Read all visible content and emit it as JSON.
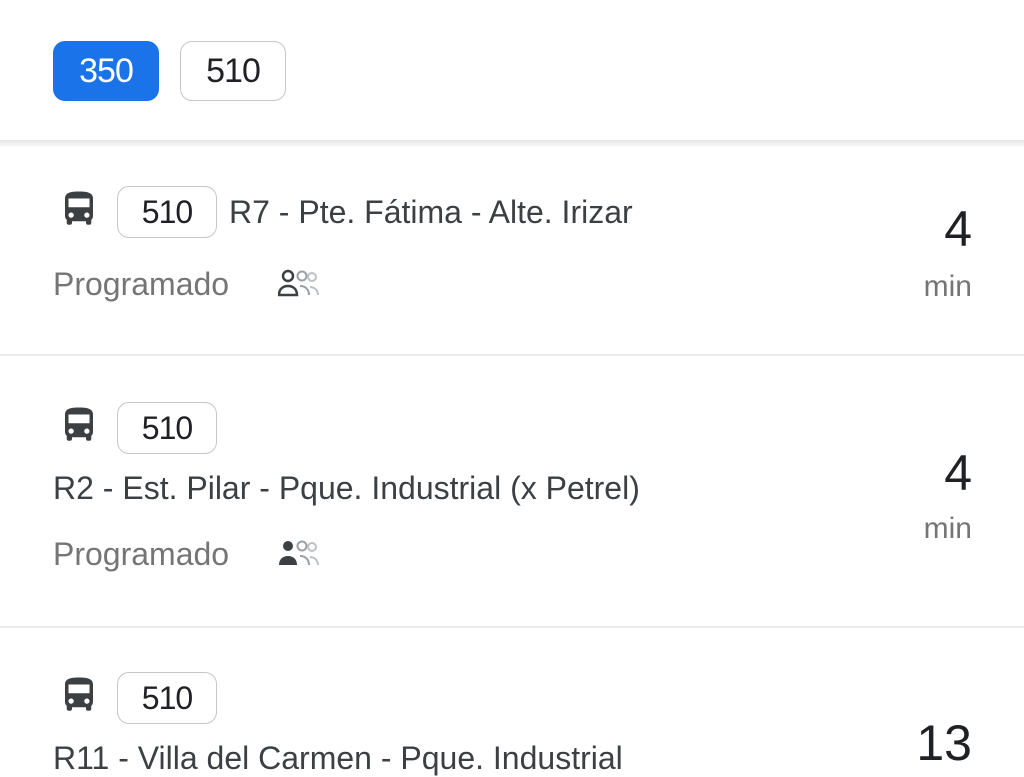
{
  "route_filters": [
    {
      "label": "350",
      "selected": true
    },
    {
      "label": "510",
      "selected": false
    }
  ],
  "departures": [
    {
      "route": "510",
      "destination": "R7 - Pte. Fátima - Alte. Irizar",
      "status": "Programado",
      "eta": "4",
      "eta_unit": "min"
    },
    {
      "route": "510",
      "destination": "R2 - Est. Pilar - Pque. Industrial (x Petrel)",
      "status": "Programado",
      "eta": "4",
      "eta_unit": "min"
    },
    {
      "route": "510",
      "destination": "R11 - Villa del Carmen - Pque. Industrial",
      "eta": "13"
    }
  ],
  "colors": {
    "accent": "#1a73e8",
    "text": "#3c4043",
    "secondary_text": "#757575",
    "chip_border": "#c6c6c6"
  },
  "icons": {
    "vehicle": "bus-icon",
    "occupancy": "crowd-level-icon"
  }
}
